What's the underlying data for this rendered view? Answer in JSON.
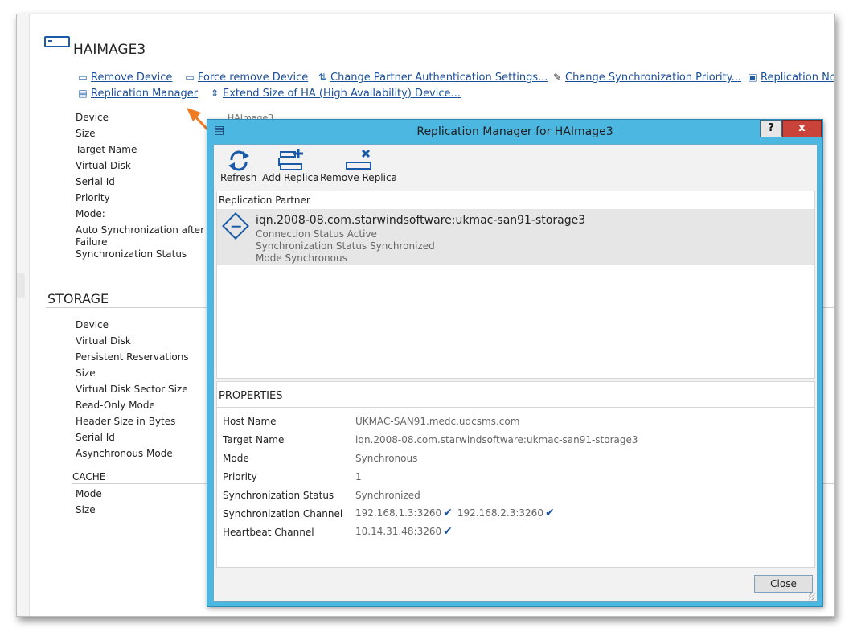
{
  "device": {
    "title": "HAIMAGE3",
    "actions": {
      "remove_device": "Remove Device",
      "force_remove_device": "Force remove Device",
      "change_partner_auth": "Change Partner Authentication Settings...",
      "change_sync_priority": "Change Synchronization Priority...",
      "replication_node": "Replication No",
      "replication_manager": "Replication Manager",
      "extend_size": "Extend Size of HA (High Availability) Device..."
    },
    "labels": [
      "Device",
      "Size",
      "Target Name",
      "Virtual Disk",
      "Serial Id",
      "Priority",
      "Mode:",
      "Auto Synchronization after",
      "Failure",
      "Synchronization Status"
    ],
    "partial_value": "HAImage3"
  },
  "storage": {
    "section_title": "STORAGE",
    "labels": [
      "Device",
      "Virtual Disk",
      "Persistent Reservations",
      "Size",
      "Virtual Disk Sector Size",
      "Read-Only Mode",
      "Header Size in Bytes",
      "Serial Id",
      "Asynchronous Mode"
    ],
    "cache_title": "CACHE",
    "cache_labels": [
      "Mode",
      "Size"
    ]
  },
  "dialog": {
    "title": "Replication Manager for HAImage3",
    "help_label": "?",
    "close_label": "x",
    "toolbar": {
      "refresh": "Refresh",
      "add_replica": "Add Replica",
      "remove_replica": "Remove Replica"
    },
    "partner_header": "Replication Partner",
    "partner": {
      "name": "iqn.2008-08.com.starwindsoftware:ukmac-san91-storage3",
      "connection_status": "Connection Status Active",
      "sync_status": "Synchronization Status Synchronized",
      "mode": "Mode Synchronous"
    },
    "properties_header": "PROPERTIES",
    "properties": [
      {
        "key": "Host Name",
        "value": "UKMAC-SAN91.medc.udcsms.com"
      },
      {
        "key": "Target Name",
        "value": "iqn.2008-08.com.starwindsoftware:ukmac-san91-storage3"
      },
      {
        "key": "Mode",
        "value": "Synchronous"
      },
      {
        "key": "Priority",
        "value": "1"
      },
      {
        "key": "Synchronization Status",
        "value": "Synchronized"
      },
      {
        "key": "Synchronization Channel",
        "value": "192.168.1.3:3260",
        "value2": "192.168.2.3:3260"
      },
      {
        "key": "Heartbeat Channel",
        "value": "10.14.31.48:3260"
      }
    ],
    "close_button": "Close"
  },
  "colors": {
    "accent_link": "#1a4f99",
    "dialog_frame": "#4cb7e1",
    "close_red": "#c9433a",
    "arrow_orange": "#f07a22"
  },
  "icons": [
    "device-icon",
    "remove-device-icon",
    "force-remove-icon",
    "auth-settings-icon",
    "wrench-icon",
    "replication-node-icon",
    "replication-manager-icon",
    "extend-size-icon",
    "refresh-icon",
    "add-replica-icon",
    "remove-replica-icon",
    "partner-diamond-icon",
    "checkmark-icon"
  ]
}
